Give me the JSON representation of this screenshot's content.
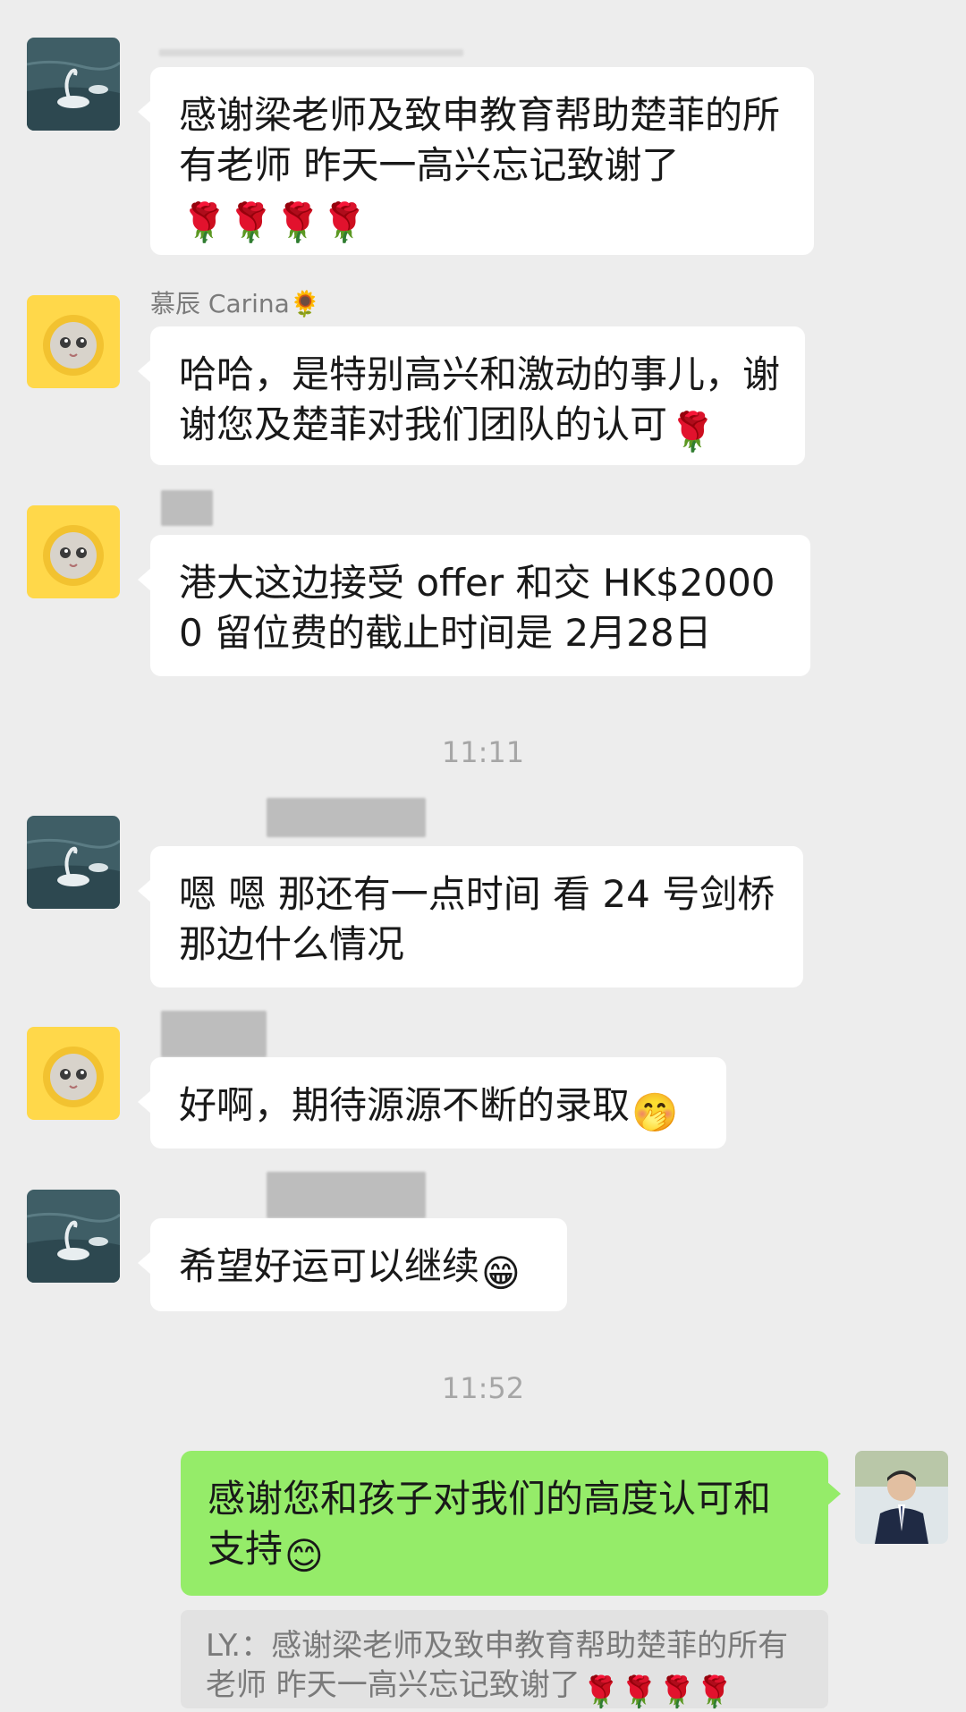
{
  "messages": [
    {
      "text": "感谢梁老师及致申教育帮助楚菲的所有老师 昨天一高兴忘记致谢了",
      "emoji": "🌹🌹🌹🌹"
    },
    {
      "sender": "慕辰 Carina🌻",
      "text": "哈哈，是特别高兴和激动的事儿，谢谢您及楚菲对我们团队的认可",
      "emoji": "🌹"
    },
    {
      "text": "港大这边接受 offer 和交 HK$20000 留位费的截止时间是 2月28日",
      "emoji": ""
    },
    {
      "text": "嗯 嗯 那还有一点时间 看 24 号剑桥那边什么情况",
      "emoji": ""
    },
    {
      "text": "好啊，期待源源不断的录取",
      "emoji": "🤭"
    },
    {
      "text": "希望好运可以继续",
      "emoji": "😁"
    },
    {
      "text": "感谢您和孩子对我们的高度认可和支持",
      "emoji": "😊"
    }
  ],
  "timestamps": {
    "t1": "11:11",
    "t2": "11:52"
  },
  "quote": {
    "text": "LY.：感谢梁老师及致申教育帮助楚菲的所有老师 昨天一高兴忘记致谢了",
    "emoji": "🌹🌹🌹🌹"
  },
  "colors": {
    "background": "#ededed",
    "incoming_bubble": "#ffffff",
    "outgoing_bubble": "#95ec69",
    "quote_bg": "#e2e2e2"
  }
}
